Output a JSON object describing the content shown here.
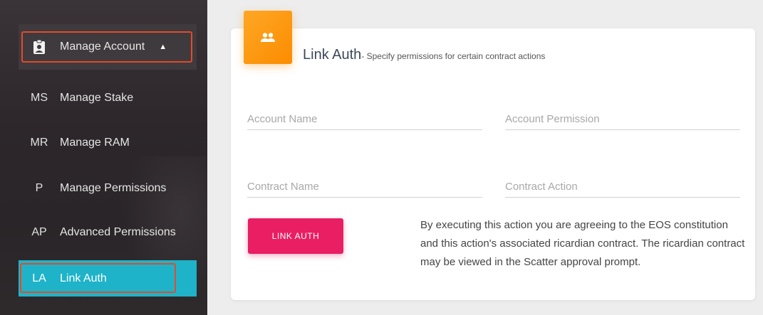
{
  "sidebar": {
    "manage_account": {
      "label": "Manage Account",
      "icon": "badge-icon",
      "expanded": true
    },
    "items": [
      {
        "abbr": "MS",
        "label": "Manage Stake"
      },
      {
        "abbr": "MR",
        "label": "Manage RAM"
      },
      {
        "abbr": "P",
        "label": "Manage Permissions"
      },
      {
        "abbr": "AP",
        "label": "Advanced Permissions"
      },
      {
        "abbr": "LA",
        "label": "Link Auth",
        "active": true
      }
    ]
  },
  "card": {
    "icon": "people-icon",
    "title": "Link Auth",
    "subtitle": "- Specify permissions for certain contract actions",
    "fields": {
      "account_name": {
        "placeholder": "Account Name",
        "value": ""
      },
      "account_permission": {
        "placeholder": "Account Permission",
        "value": ""
      },
      "contract_name": {
        "placeholder": "Contract Name",
        "value": ""
      },
      "contract_action": {
        "placeholder": "Contract Action",
        "value": ""
      }
    },
    "button_label": "LINK AUTH",
    "disclaimer": "By executing this action you are agreeing to the EOS constitution and this action's associated ricardian contract. The ricardian contract may be viewed in the Scatter approval prompt."
  },
  "colors": {
    "active_item": "#1eb3c9",
    "highlight_outline": "#e24b2b",
    "card_icon": "#fb8c00",
    "button": "#e91e63"
  }
}
